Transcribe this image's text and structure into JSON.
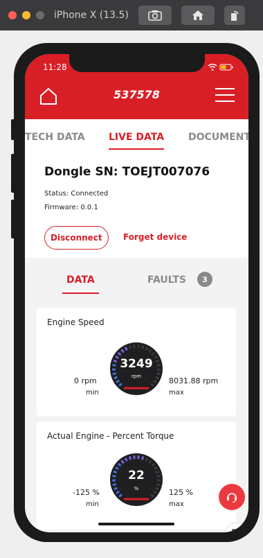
{
  "simulator": {
    "title": "iPhone X (13.5)",
    "traffic_lights": [
      "#ff5f57",
      "#febc2e",
      "#6b6b6b"
    ],
    "toolbar": [
      "screenshot-icon",
      "home-icon",
      "rotate-icon"
    ]
  },
  "status_bar": {
    "time": "11:28",
    "icons": "... wifi battery"
  },
  "header": {
    "title": "537578",
    "color": "#d91f26"
  },
  "top_tabs": [
    {
      "label": "TECH DATA",
      "active": false
    },
    {
      "label": "LIVE DATA",
      "active": true
    },
    {
      "label": "DOCUMENT",
      "active": false
    }
  ],
  "device": {
    "dongle": "Dongle SN: TOEJT007076",
    "status": "Status: Connected",
    "firmware": "Firmware: 0.0.1",
    "disconnect_label": "Disconnect",
    "forget_label": "Forget device"
  },
  "sub_tabs": {
    "data_label": "DATA",
    "faults_label": "FAULTS",
    "faults_count": "3"
  },
  "cards": [
    {
      "title": "Engine Speed",
      "value": "3249",
      "unit": "rpm",
      "min_value": "0 rpm",
      "min_label": "min",
      "max_value": "8031.88 rpm",
      "max_label": "max",
      "level": 0.4
    },
    {
      "title": "Actual Engine - Percent Torque",
      "value": "22",
      "unit": "%",
      "min_value": "-125 %",
      "min_label": "min",
      "max_value": "125 %",
      "max_label": "max",
      "level": 0.59
    }
  ],
  "floating": {
    "support_icon": "headset-icon",
    "download_icon": "download-icon"
  }
}
